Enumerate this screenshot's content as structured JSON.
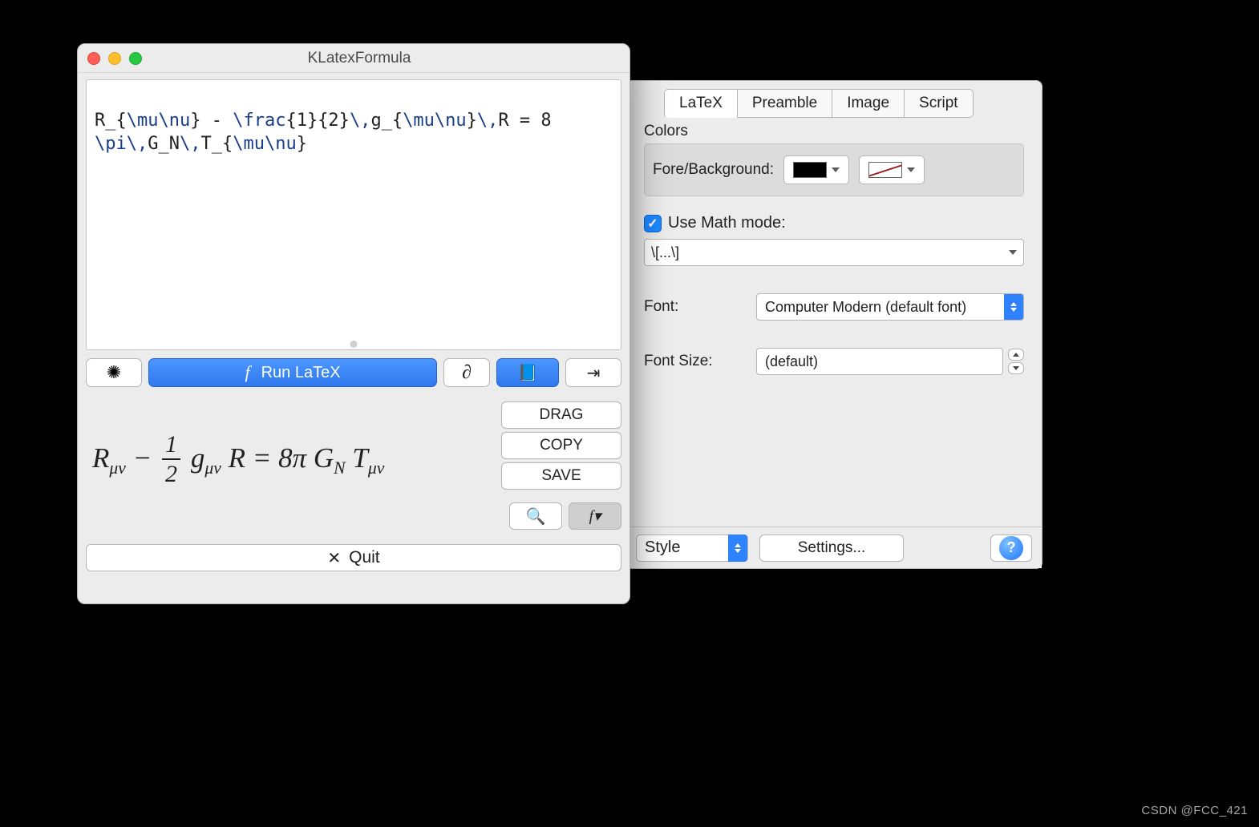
{
  "window": {
    "title": "KLatexFormula",
    "latex_plain": "R_{\\mu\\nu} - \\frac{1}{2}\\,g_{\\mu\\nu}\\,R = 8\\pi\\,G_N\\,T_{\\mu\\nu}",
    "toolbar": {
      "run_label": "Run LaTeX",
      "partial_symbol": "∂",
      "brightness_symbol": "✳",
      "book_symbol": "▤",
      "collapse_symbol": "⇥"
    },
    "formula_text": "R_{μν} − 1/2 g_{μν} R = 8π G_N T_{μν}",
    "actions": {
      "drag": "DRAG",
      "copy": "COPY",
      "save": "SAVE"
    },
    "quit_label": "Quit"
  },
  "panel": {
    "tabs": [
      "LaTeX",
      "Preamble",
      "Image",
      "Script"
    ],
    "active_tab": 0,
    "colors_title": "Colors",
    "fore_back_label": "Fore/Background:",
    "foreground_color": "#000000",
    "background_transparent": true,
    "math_mode_checked": true,
    "math_mode_label": "Use Math mode:",
    "math_mode_value": "\\[...\\]",
    "font_label": "Font:",
    "font_value": "Computer Modern (default font)",
    "font_size_label": "Font Size:",
    "font_size_value": "(default)",
    "style_label": "Style",
    "settings_label": "Settings..."
  },
  "watermark": "CSDN @FCC_421"
}
